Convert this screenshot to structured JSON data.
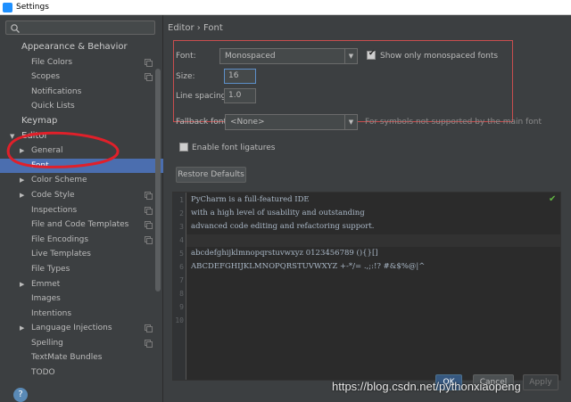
{
  "window": {
    "title": "Settings"
  },
  "sidebar": {
    "search_placeholder": "",
    "items": [
      {
        "label": "Appearance & Behavior",
        "level": 0,
        "arrow": ""
      },
      {
        "label": "File Colors",
        "level": 1,
        "copy": true
      },
      {
        "label": "Scopes",
        "level": 1,
        "copy": true
      },
      {
        "label": "Notifications",
        "level": 1
      },
      {
        "label": "Quick Lists",
        "level": 1
      },
      {
        "label": "Keymap",
        "level": 0
      },
      {
        "label": "Editor",
        "level": 0,
        "arrow": "▼"
      },
      {
        "label": "General",
        "level": 1,
        "arrow": "▶"
      },
      {
        "label": "Font",
        "level": 1,
        "selected": true
      },
      {
        "label": "Color Scheme",
        "level": 1,
        "arrow": "▶"
      },
      {
        "label": "Code Style",
        "level": 1,
        "arrow": "▶",
        "copy": true
      },
      {
        "label": "Inspections",
        "level": 1,
        "copy": true
      },
      {
        "label": "File and Code Templates",
        "level": 1,
        "copy": true
      },
      {
        "label": "File Encodings",
        "level": 1,
        "copy": true
      },
      {
        "label": "Live Templates",
        "level": 1
      },
      {
        "label": "File Types",
        "level": 1
      },
      {
        "label": "Emmet",
        "level": 1,
        "arrow": "▶"
      },
      {
        "label": "Images",
        "level": 1
      },
      {
        "label": "Intentions",
        "level": 1
      },
      {
        "label": "Language Injections",
        "level": 1,
        "arrow": "▶",
        "copy": true
      },
      {
        "label": "Spelling",
        "level": 1,
        "copy": true
      },
      {
        "label": "TextMate Bundles",
        "level": 1
      },
      {
        "label": "TODO",
        "level": 1
      }
    ]
  },
  "breadcrumb": {
    "root": "Editor",
    "separator": "›",
    "current": "Font"
  },
  "font_settings": {
    "font_label": "Font:",
    "font_value": "Monospaced",
    "monospaced_only_label": "Show only monospaced fonts",
    "monospaced_only_checked": true,
    "size_label": "Size:",
    "size_value": "16",
    "line_spacing_label": "Line spacing:",
    "line_spacing_value": "1.0"
  },
  "fallback": {
    "label": "Fallback font:",
    "value": "<None>",
    "hint": "For symbols not supported by the main font"
  },
  "ligatures": {
    "label": "Enable font ligatures",
    "checked": false
  },
  "restore_button": "Restore Defaults",
  "preview": {
    "line_numbers": [
      "1",
      "2",
      "3",
      "4",
      "5",
      "6",
      "7",
      "8",
      "9",
      "10"
    ],
    "lines": [
      "PyCharm is a full-featured IDE",
      "with a high level of usability and outstanding",
      "advanced code editing and refactoring support.",
      "",
      "abcdefghijklmnopqrstuvwxyz 0123456789 (){}[]",
      "ABCDEFGHIJKLMNOPQRSTUVWXYZ +-*/= .,;:!? #&$%@|^",
      "",
      "",
      "",
      ""
    ]
  },
  "footer": {
    "ok": "OK",
    "cancel": "Cancel",
    "apply": "Apply"
  },
  "watermark": "https://blog.csdn.net/pythonxiaopeng",
  "colors": {
    "background": "#3c3f41",
    "selection": "#4b6eaf",
    "highlight_box": "#c94e4e",
    "annotation": "#e0202a",
    "editor_bg": "#2b2b2b"
  }
}
